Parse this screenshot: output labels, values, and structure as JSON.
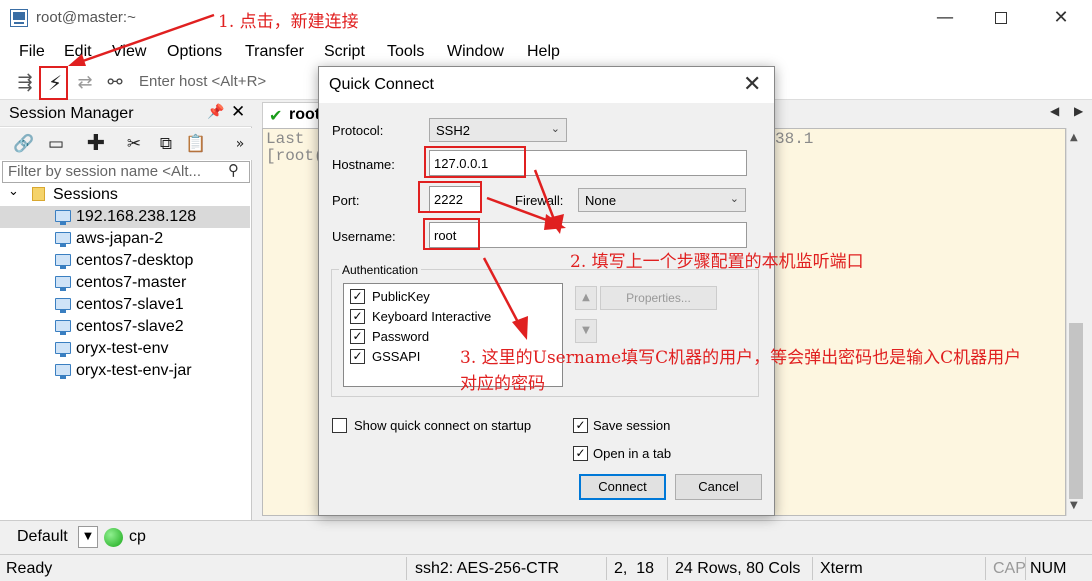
{
  "window": {
    "title": "root@master:~",
    "min_glyph": "—",
    "close_glyph": "✕"
  },
  "menu": [
    "File",
    "Edit",
    "View",
    "Options",
    "Transfer",
    "Script",
    "Tools",
    "Window",
    "Help"
  ],
  "toolbar": {
    "host_placeholder": "Enter host <Alt+R>"
  },
  "session_manager": {
    "title": "Session Manager",
    "filter_placeholder": "Filter by session name <Alt...",
    "folder": "Sessions",
    "sessions": [
      "192.168.238.128",
      "aws-japan-2",
      "centos7-desktop",
      "centos7-master",
      "centos7-slave1",
      "centos7-slave2",
      "oryx-test-env",
      "oryx-test-env-jar"
    ],
    "selected_index": 0
  },
  "terminal": {
    "tab_label": "root",
    "lines": [
      "Last",
      "[root("
    ],
    "right_fragment": "38.1"
  },
  "dialog": {
    "title": "Quick Connect",
    "protocol_label": "Protocol:",
    "protocol_value": "SSH2",
    "hostname_label": "Hostname:",
    "hostname_value": "127.0.0.1",
    "port_label": "Port:",
    "port_value": "2222",
    "firewall_label": "Firewall:",
    "firewall_value": "None",
    "username_label": "Username:",
    "username_value": "root",
    "auth_group_label": "Authentication",
    "auth_methods": [
      {
        "label": "PublicKey",
        "checked": true
      },
      {
        "label": "Keyboard Interactive",
        "checked": true
      },
      {
        "label": "Password",
        "checked": true
      },
      {
        "label": "GSSAPI",
        "checked": true
      }
    ],
    "properties_label": "Properties...",
    "show_on_startup_label": "Show quick connect on startup",
    "show_on_startup_checked": false,
    "save_session_label": "Save session",
    "save_session_checked": true,
    "open_in_tab_label": "Open in a tab",
    "open_in_tab_checked": true,
    "connect_label": "Connect",
    "cancel_label": "Cancel"
  },
  "button_bar": {
    "label": "Default",
    "button": "cp"
  },
  "status_bar": {
    "ready": "Ready",
    "cipher": "ssh2: AES-256-CTR",
    "position": "2,  18",
    "size": "24 Rows, 80 Cols",
    "terminal_type": "Xterm",
    "cap": "CAP",
    "num": "NUM"
  },
  "annotations": {
    "step1": "1. 点击，新建连接",
    "step2": "2. 填写上一个步骤配置的本机监听端口",
    "step3_line1": "3. 这里的Username填写C机器的用户，等会弹出密码也是输入C机器用户",
    "step3_line2": "对应的密码"
  },
  "colors": {
    "annotation_red": "#e02020",
    "terminal_bg": "#fdf6e0",
    "connected_green": "#1a9c1a",
    "default_button_border": "#0078d7"
  }
}
